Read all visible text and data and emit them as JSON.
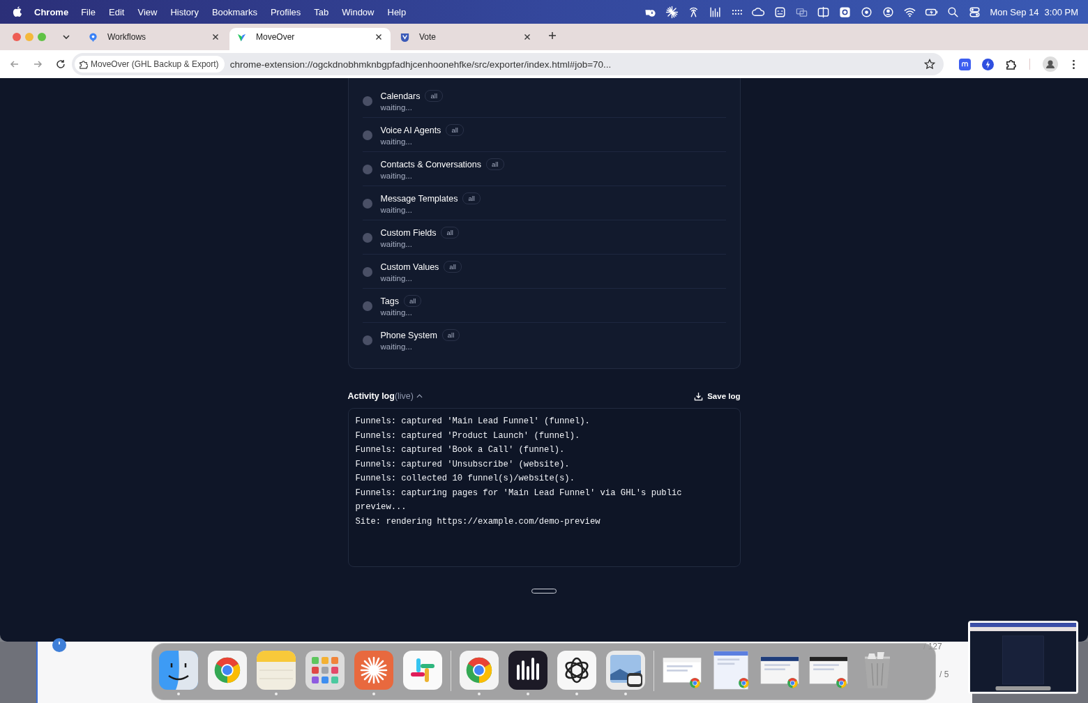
{
  "menu_bar": {
    "app": "Chrome",
    "menus": [
      "File",
      "Edit",
      "View",
      "History",
      "Bookmarks",
      "Profiles",
      "Tab",
      "Window",
      "Help"
    ],
    "date": "Mon Sep 14",
    "time": "3:00 PM"
  },
  "browser": {
    "tabs": [
      {
        "title": "Workflows",
        "selected": false
      },
      {
        "title": "MoveOver",
        "selected": true
      },
      {
        "title": "Vote",
        "selected": false
      }
    ],
    "site_chip": "MoveOver (GHL Backup & Export)",
    "url": "chrome-extension://ogckdnobhmknbgpfadhjcenhoonehfke/src/exporter/index.html#job=70..."
  },
  "jobs": [
    {
      "name": "Calendars",
      "scope": "all",
      "status": "waiting..."
    },
    {
      "name": "Voice AI Agents",
      "scope": "all",
      "status": "waiting..."
    },
    {
      "name": "Contacts & Conversations",
      "scope": "all",
      "status": "waiting..."
    },
    {
      "name": "Message Templates",
      "scope": "all",
      "status": "waiting..."
    },
    {
      "name": "Custom Fields",
      "scope": "all",
      "status": "waiting..."
    },
    {
      "name": "Custom Values",
      "scope": "all",
      "status": "waiting..."
    },
    {
      "name": "Tags",
      "scope": "all",
      "status": "waiting..."
    },
    {
      "name": "Phone System",
      "scope": "all",
      "status": "waiting..."
    }
  ],
  "activity_log": {
    "title": "Activity log",
    "live": "(live)",
    "expanded": true,
    "save_label": "Save log",
    "lines": [
      "Funnels: captured 'Main Lead Funnel' (funnel).",
      "Funnels: captured 'Product Launch' (funnel).",
      "Funnels: captured 'Book a Call' (funnel).",
      "Funnels: captured 'Unsubscribe' (website).",
      "Funnels: collected 10 funnel(s)/website(s).",
      "Funnels: capturing pages for 'Main Lead Funnel' via GHL's public preview...",
      "Site: rendering https://example.com/demo-preview"
    ]
  },
  "background_window": {
    "counts": [
      "/ 127",
      "/ 5"
    ]
  }
}
